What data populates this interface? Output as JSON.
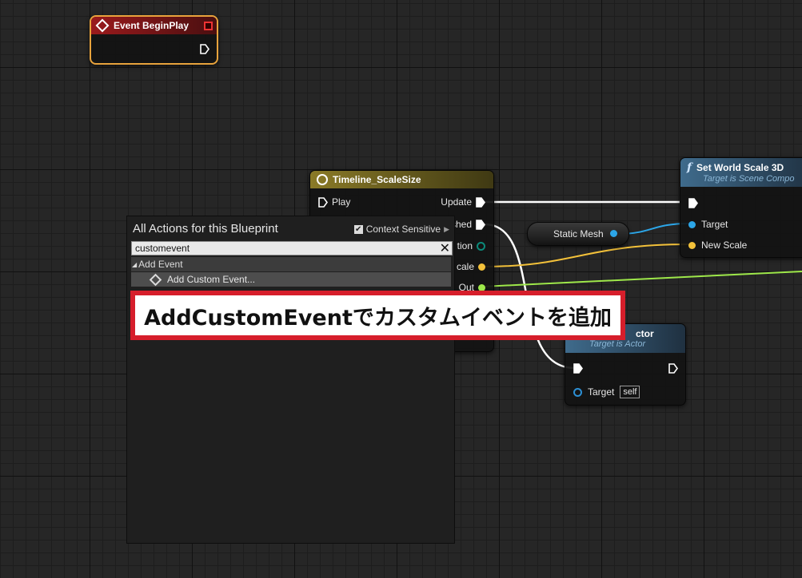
{
  "nodes": {
    "begin_play": {
      "title": "Event BeginPlay"
    },
    "timeline": {
      "title": "Timeline_ScaleSize",
      "pins_in": [
        "Play"
      ],
      "pins_out": [
        "Update",
        "Finished",
        "Direction",
        "Scale",
        "Out"
      ],
      "partial_pins_out": [
        "shed",
        "tion",
        "cale",
        "Out"
      ]
    },
    "set_world_scale": {
      "title": "Set World Scale 3D",
      "subtitle": "Target is Scene Component",
      "subtitle_visible": "Target is Scene Compo",
      "pin_target": "Target",
      "pin_new_scale": "New Scale"
    },
    "static_mesh": {
      "label": "Static Mesh"
    },
    "destroy_actor": {
      "title_visible": "ctor",
      "subtitle_visible": "Target is Actor",
      "pin_target": "Target",
      "self_label": "self"
    }
  },
  "action_menu": {
    "title": "All Actions for this Blueprint",
    "context_sensitive_label": "Context Sensitive",
    "context_sensitive_checked": true,
    "search_value": "customevent",
    "category": "Add Event",
    "items": [
      {
        "label": "Add Custom Event..."
      }
    ]
  },
  "annotation": {
    "text": "AddCustomEventでカスタムイベントを追加"
  },
  "colors": {
    "exec_wire": "#ffffff",
    "object_pin": "#2ca6e8",
    "vector_pin": "#f3c13a",
    "float_pin": "#9ee84a",
    "annotation_border": "#d61e2b",
    "event_header": "#8e1518",
    "timeline_header": "#8a7a27",
    "function_header": "#36607e",
    "selection_outline": "#e8a33c"
  }
}
